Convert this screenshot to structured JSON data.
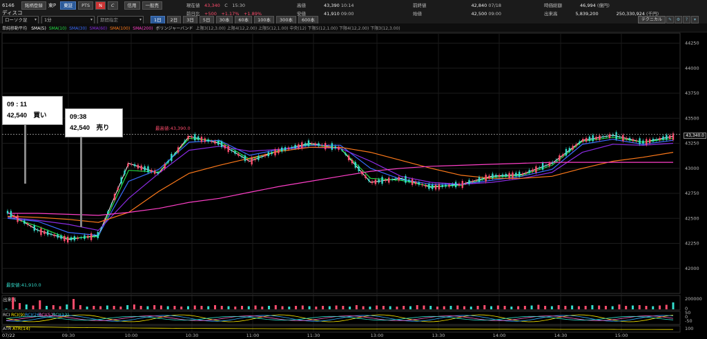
{
  "header": {
    "code": "6146",
    "name": "ディスコ",
    "btn_register": "銘柄登録",
    "exchange": "東P",
    "btn_tokyo": "東証",
    "btn_pts": "PTS",
    "btn_n": "N",
    "btn_zoom": "𝘊",
    "trade_btn": "信用",
    "trade_btn2": "一般売",
    "chart_type": "ローソク足",
    "interval": "1分",
    "period": "期間指定",
    "ranges": [
      "1日",
      "2日",
      "3日",
      "5日",
      "30本",
      "60本",
      "100本",
      "300本",
      "600本"
    ],
    "quote": {
      "last_label": "現在値",
      "last": "43,340",
      "last_mark": "C",
      "last_time": "15:30",
      "chg_label": "前日比",
      "chg": "+500",
      "chg_pct": "+1.17%",
      "chg_pct2": "+1.89%",
      "high_label": "高値",
      "high": "43,390",
      "high_time": "10:14",
      "low_label": "安値",
      "low": "41,910",
      "low_time": "09:00",
      "prev_label": "前終値",
      "prev": "42,840",
      "prev_date": "07/18",
      "open_label": "始値",
      "open": "42,500",
      "open_time": "09:00",
      "value_label": "時価総額",
      "value": "46,994",
      "value_unit": "(億円)",
      "volume_label": "出来高",
      "volume": "5,839,200",
      "turnover": "250,330,924",
      "turnover_unit": "(千円)"
    }
  },
  "indicators": {
    "title": "単純移動平均",
    "items": [
      {
        "label": "SMA(5)",
        "color": "#ffffff"
      },
      {
        "label": "SMA(10)",
        "color": "#22dd44"
      },
      {
        "label": "SMA(30)",
        "color": "#3a6bff"
      },
      {
        "label": "SMA(60)",
        "color": "#8a2be2"
      },
      {
        "label": "SMA(100)",
        "color": "#ff7a1a"
      },
      {
        "label": "SMA(200)",
        "color": "#ff3fc8"
      }
    ],
    "bollinger": "ボリンジャーバンド",
    "bands": "上限3(12,3.00)  上限4(12,2.00)  上限5(12,1.00)  中央(12)  下限5(12,1.00)  下限4(12,2.00)  下限3(12,3.00)",
    "technical_btn": "テクニカル"
  },
  "chart_data": {
    "type": "line",
    "ylim": [
      41750,
      44350
    ],
    "y_ticks": [
      "44250",
      "44000",
      "43750",
      "43500",
      "43250",
      "43000",
      "42750",
      "42500",
      "42250",
      "42000"
    ],
    "x_ticks": [
      "09:30",
      "10:00",
      "10:30",
      "11:00",
      "11:30",
      "13:00",
      "13:30",
      "14:00",
      "14:30",
      "15:00"
    ],
    "date_label": "07/22",
    "high_marker": "最高値:43,390.0",
    "low_marker": "最安値:41,910.0",
    "last_price_tag": "43,340.0",
    "series": [
      {
        "name": "SMA(5)",
        "color": "#ffffff",
        "values": [
          42560,
          42380,
          42290,
          42330,
          43050,
          42950,
          43320,
          43250,
          43070,
          43180,
          43250,
          43200,
          42860,
          42900,
          42810,
          42840,
          42920,
          42940,
          43050,
          43280,
          43330,
          43260,
          43320
        ]
      },
      {
        "name": "SMA(10)",
        "color": "#22dd44",
        "values": [
          42520,
          42420,
          42300,
          42320,
          42980,
          42960,
          43300,
          43270,
          43090,
          43180,
          43240,
          43200,
          42900,
          42880,
          42820,
          42830,
          42910,
          42930,
          43030,
          43270,
          43310,
          43260,
          43300
        ]
      },
      {
        "name": "SMA(30)",
        "color": "#3a6bff",
        "values": [
          42500,
          42470,
          42360,
          42330,
          42870,
          42990,
          43260,
          43280,
          43130,
          43190,
          43230,
          43230,
          43000,
          42890,
          42840,
          42840,
          42880,
          42920,
          42990,
          43240,
          43290,
          43240,
          43280
        ]
      },
      {
        "name": "SMA(60)",
        "color": "#8a2be2",
        "values": [
          42510,
          42480,
          42440,
          42380,
          42700,
          42950,
          43180,
          43220,
          43170,
          43190,
          43210,
          43200,
          43070,
          42920,
          42860,
          42840,
          42860,
          42900,
          42960,
          43160,
          43240,
          43230,
          43250
        ]
      },
      {
        "name": "SMA(100)",
        "color": "#ff7a1a",
        "values": [
          42520,
          42510,
          42490,
          42460,
          42560,
          42770,
          42950,
          43030,
          43100,
          43170,
          43210,
          43210,
          43160,
          43080,
          43000,
          42930,
          42900,
          42900,
          42920,
          43000,
          43070,
          43110,
          43160
        ]
      },
      {
        "name": "SMA(200)",
        "color": "#ff3fc8",
        "values": [
          42550,
          42550,
          42540,
          42530,
          42560,
          42600,
          42660,
          42700,
          42760,
          42820,
          42870,
          42920,
          42970,
          43000,
          43020,
          43030,
          43040,
          43050,
          43060,
          43060,
          43060,
          43060,
          43060
        ]
      }
    ],
    "volume_label": "出来高",
    "volume_ticks": [
      "200000",
      "0"
    ],
    "volumes": [
      2,
      35,
      18,
      14,
      11,
      26,
      10,
      12,
      9,
      14,
      30,
      12,
      8,
      10,
      9,
      11,
      10,
      8,
      12,
      14,
      10,
      9,
      12,
      11,
      9,
      10,
      8,
      9,
      11,
      10,
      9,
      12,
      10,
      9,
      8,
      10,
      9,
      11,
      8,
      10,
      12,
      9,
      8,
      10,
      11,
      9,
      8,
      10,
      9,
      11,
      10,
      8,
      12,
      9,
      8,
      11,
      10,
      9,
      8,
      10,
      9,
      12,
      11,
      10,
      8,
      9,
      10,
      11,
      9,
      8,
      10,
      12,
      9,
      11,
      10,
      8,
      9,
      10,
      11,
      13,
      10,
      9,
      12,
      10,
      11,
      9,
      10,
      12,
      11,
      10,
      9,
      14,
      10,
      11,
      12,
      10,
      9,
      11,
      13,
      20
    ],
    "rci_label": "RCI",
    "rci_items": [
      "RCI(9)",
      "RCI(26)",
      "RCI(52)",
      "RCI(12)"
    ],
    "rci_ticks": [
      "50",
      "0",
      "-50"
    ],
    "atr_label": "ATR",
    "atr_item": "ATR(14)",
    "atr_ticks": [
      "100"
    ]
  },
  "annotations": [
    {
      "time": "09 : 11",
      "text": "42,540　買い"
    },
    {
      "time": "09:38",
      "text": "42,540　売り"
    }
  ]
}
